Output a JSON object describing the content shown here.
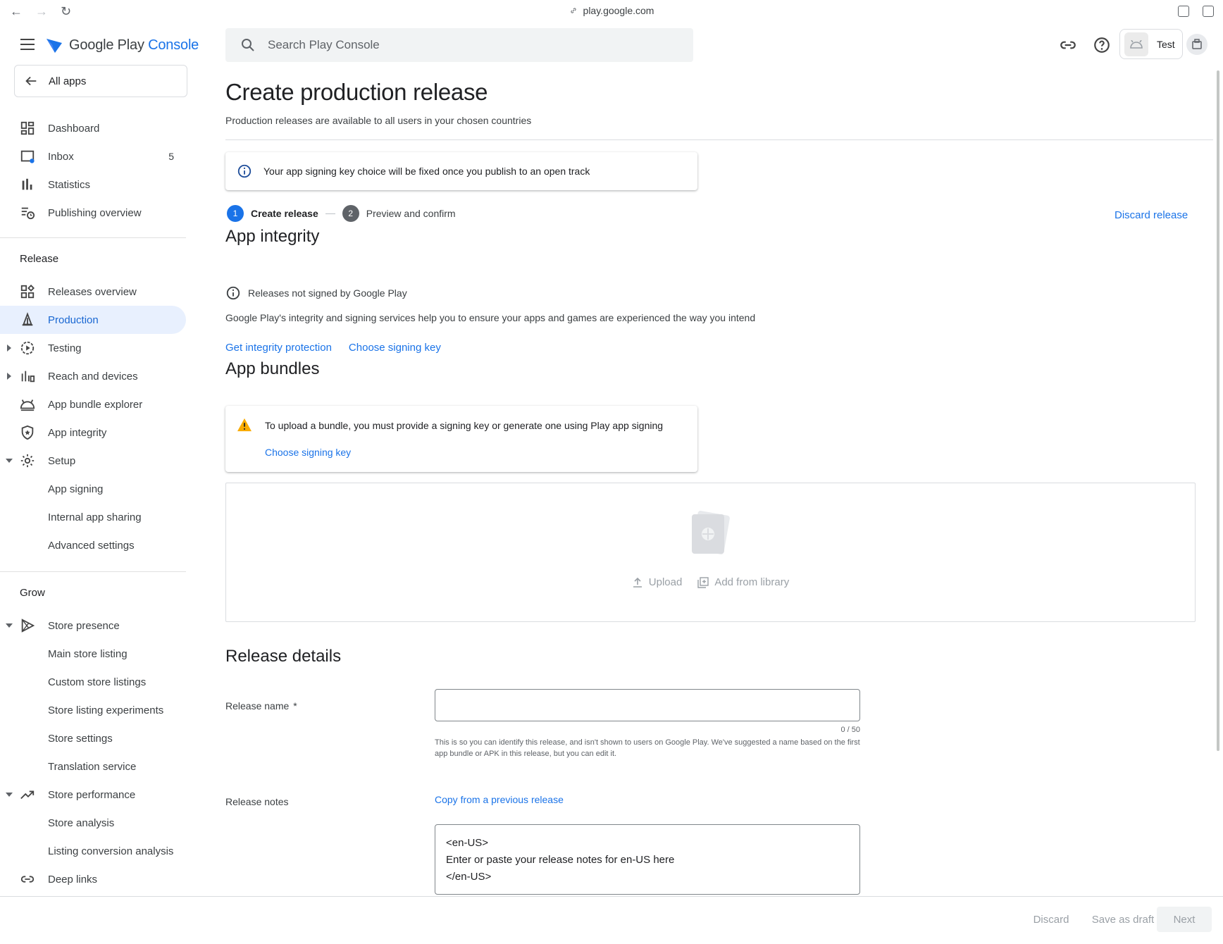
{
  "browser": {
    "url": "play.google.com"
  },
  "brand": {
    "google_play": "Google Play",
    "console": "Console"
  },
  "search": {
    "placeholder": "Search Play Console"
  },
  "account": {
    "name": "Test"
  },
  "sidebar": {
    "all_apps": "All apps",
    "items": [
      {
        "label": "Dashboard",
        "icon": "dashboard-icon"
      },
      {
        "label": "Inbox",
        "icon": "inbox-icon",
        "count": "5"
      },
      {
        "label": "Statistics",
        "icon": "statistics-icon"
      },
      {
        "label": "Publishing overview",
        "icon": "publishing-icon"
      }
    ],
    "release_group": "Release",
    "release_items": [
      {
        "label": "Releases overview",
        "icon": "releases-overview-icon"
      },
      {
        "label": "Production",
        "icon": "production-icon",
        "active": true
      },
      {
        "label": "Testing",
        "icon": "testing-icon"
      },
      {
        "label": "Reach and devices",
        "icon": "reach-devices-icon"
      },
      {
        "label": "App bundle explorer",
        "icon": "bundle-explorer-icon"
      },
      {
        "label": "App integrity",
        "icon": "shield-icon"
      },
      {
        "label": "Setup",
        "icon": "gear-icon"
      },
      {
        "label": "App signing"
      },
      {
        "label": "Internal app sharing"
      },
      {
        "label": "Advanced settings"
      }
    ],
    "grow_group": "Grow",
    "grow_items": [
      {
        "label": "Store presence",
        "icon": "store-presence-icon"
      },
      {
        "label": "Main store listing"
      },
      {
        "label": "Custom store listings"
      },
      {
        "label": "Store listing experiments"
      },
      {
        "label": "Store settings"
      },
      {
        "label": "Translation service"
      },
      {
        "label": "Store performance",
        "icon": "trending-icon"
      },
      {
        "label": "Store analysis"
      },
      {
        "label": "Listing conversion analysis"
      },
      {
        "label": "Deep links",
        "icon": "link-icon"
      }
    ]
  },
  "main": {
    "title": "Create production release",
    "subtitle": "Production releases are available to all users in your chosen countries",
    "info_banner": "Your app signing key choice will be fixed once you publish to an open track",
    "steps": [
      {
        "num": "1",
        "label": "Create release"
      },
      {
        "num": "2",
        "label": "Preview and confirm"
      }
    ],
    "discard_release": "Discard release",
    "app_integrity": {
      "heading": "App integrity",
      "status": "Releases not signed by Google Play",
      "description": "Google Play's integrity and signing services help you to ensure your apps and games are experienced the way you intend",
      "link_protection": "Get integrity protection",
      "link_signing": "Choose signing key"
    },
    "app_bundles": {
      "heading": "App bundles",
      "warning": "To upload a bundle, you must provide a signing key or generate one using Play app signing",
      "warning_link": "Choose signing key",
      "upload": "Upload",
      "add_from_library": "Add from library"
    },
    "release_details": {
      "heading": "Release details",
      "name_label": "Release name",
      "required_mark": "*",
      "name_value": "",
      "name_counter": "0 / 50",
      "name_helper": "This is so you can identify this release, and isn't shown to users on Google Play. We've suggested a name based on the first app bundle or APK in this release, but you can edit it.",
      "notes_label": "Release notes",
      "copy_previous": "Copy from a previous release",
      "notes_value": "<en-US>\nEnter or paste your release notes for en-US here\n</en-US>"
    }
  },
  "footer": {
    "discard": "Discard",
    "save_draft": "Save as draft",
    "next": "Next"
  },
  "colors": {
    "accent": "#1a73e8",
    "active_bg": "#e8f0fe",
    "warning": "#f9ab00"
  }
}
